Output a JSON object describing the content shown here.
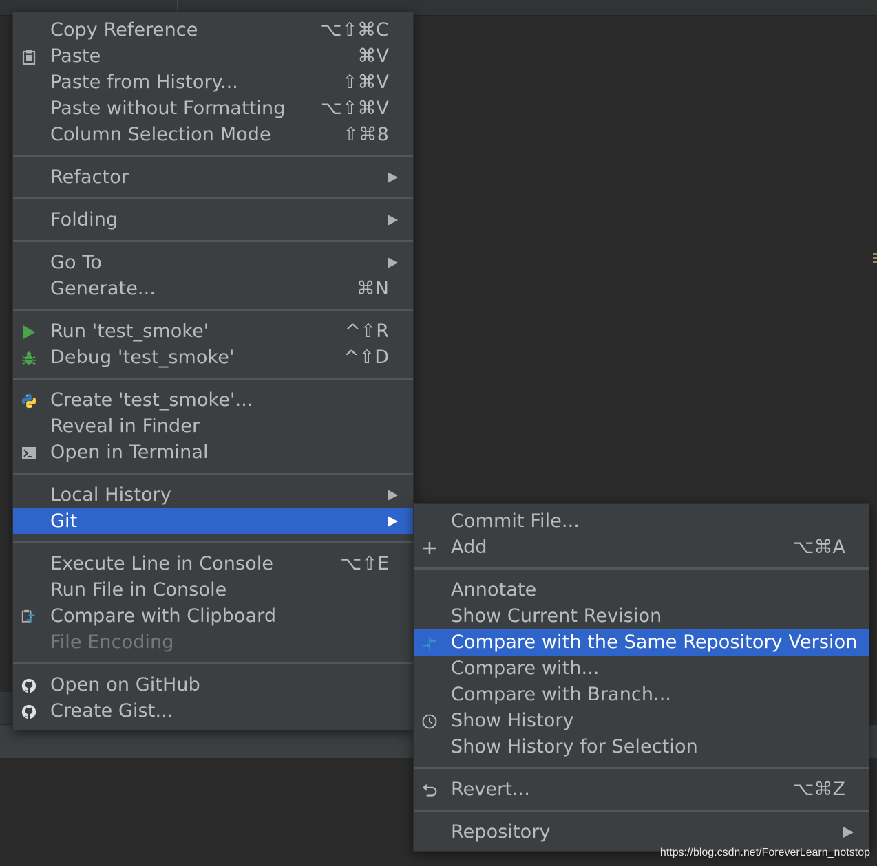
{
  "context_menu": {
    "items": [
      {
        "label": "Copy Reference",
        "shortcut": "⌥⇧⌘C"
      },
      {
        "label": "Paste",
        "shortcut": "⌘V",
        "icon": "clipboard-icon"
      },
      {
        "label": "Paste from History...",
        "shortcut": "⇧⌘V"
      },
      {
        "label": "Paste without Formatting",
        "shortcut": "⌥⇧⌘V"
      },
      {
        "label": "Column Selection Mode",
        "shortcut": "⇧⌘8"
      },
      {
        "label": "Refactor",
        "submenu": true
      },
      {
        "label": "Folding",
        "submenu": true
      },
      {
        "label": "Go To",
        "submenu": true
      },
      {
        "label": "Generate...",
        "shortcut": "⌘N"
      },
      {
        "label": "Run 'test_smoke'",
        "shortcut": "^⇧R",
        "icon": "run-icon"
      },
      {
        "label": "Debug 'test_smoke'",
        "shortcut": "^⇧D",
        "icon": "debug-icon"
      },
      {
        "label": "Create 'test_smoke'...",
        "icon": "python-icon"
      },
      {
        "label": "Reveal in Finder"
      },
      {
        "label": "Open in Terminal",
        "icon": "terminal-icon"
      },
      {
        "label": "Local History",
        "submenu": true
      },
      {
        "label": "Git",
        "submenu": true,
        "selected": true
      },
      {
        "label": "Execute Line in Console",
        "shortcut": "⌥⇧E"
      },
      {
        "label": "Run File in Console"
      },
      {
        "label": "Compare with Clipboard",
        "icon": "compare-clipboard-icon"
      },
      {
        "label": "File Encoding",
        "disabled": true
      },
      {
        "label": "Open on GitHub",
        "icon": "github-icon"
      },
      {
        "label": "Create Gist...",
        "icon": "github-icon"
      }
    ]
  },
  "git_submenu": {
    "items": [
      {
        "label": "Commit File..."
      },
      {
        "label": "Add",
        "shortcut": "⌥⌘A",
        "icon": "plus-icon"
      },
      {
        "label": "Annotate"
      },
      {
        "label": "Show Current Revision"
      },
      {
        "label": "Compare with the Same Repository Version",
        "selected": true,
        "icon": "compare-icon"
      },
      {
        "label": "Compare with..."
      },
      {
        "label": "Compare with Branch..."
      },
      {
        "label": "Show History",
        "icon": "clock-icon"
      },
      {
        "label": "Show History for Selection"
      },
      {
        "label": "Revert...",
        "shortcut": "⌥⌘Z",
        "icon": "revert-icon"
      },
      {
        "label": "Repository",
        "submenu": true
      }
    ]
  },
  "colors": {
    "menu_background": "#3c3f41",
    "selection": "#2f65ca",
    "text": "#bbbbbb",
    "disabled_text": "#777777",
    "editor_background": "#2b2b2b"
  },
  "watermark": "https://blog.csdn.net/ForeverLearn_notstop"
}
